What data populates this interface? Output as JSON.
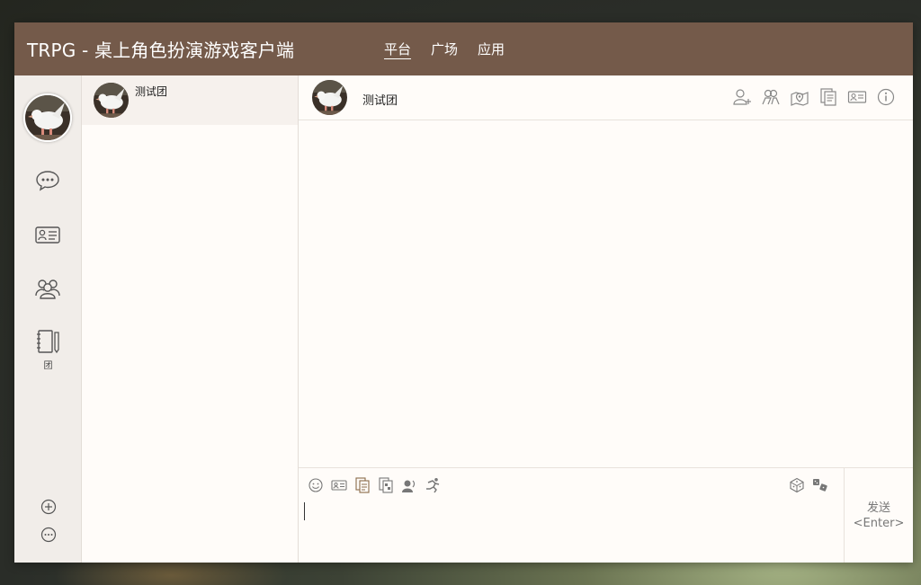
{
  "titlebar": {
    "title": "TRPG - 桌上角色扮演游戏客户端",
    "nav": [
      {
        "label": "平台",
        "active": true
      },
      {
        "label": "广场",
        "active": false
      },
      {
        "label": "应用",
        "active": false
      }
    ]
  },
  "sidebar": {
    "icons": [
      "chat-bubble-icon",
      "id-card-icon",
      "group-icon",
      "notebook-icon"
    ],
    "group_label": "团",
    "bottom_icons": [
      "add-circle-icon",
      "more-circle-icon"
    ]
  },
  "conversations": [
    {
      "name": "测试团",
      "avatar": "dove-avatar"
    }
  ],
  "chat": {
    "title": "测试团",
    "header_icons": [
      "add-member-icon",
      "members-icon",
      "map-icon",
      "documents-icon",
      "actor-card-icon",
      "info-icon"
    ],
    "toolbar_icons": [
      "emoji-icon",
      "card-icon",
      "document-send-icon",
      "file-send-icon",
      "voice-icon",
      "action-icon"
    ],
    "toolbar_right_icons": [
      "dice-icon",
      "dice-roll-icon"
    ],
    "input": {
      "value": "",
      "placeholder": ""
    },
    "send": {
      "label": "发送",
      "shortcut": "<Enter>"
    }
  },
  "colors": {
    "titlebar": "#745a4a",
    "background": "#fffcf9",
    "sidebar": "#f1ede9"
  }
}
